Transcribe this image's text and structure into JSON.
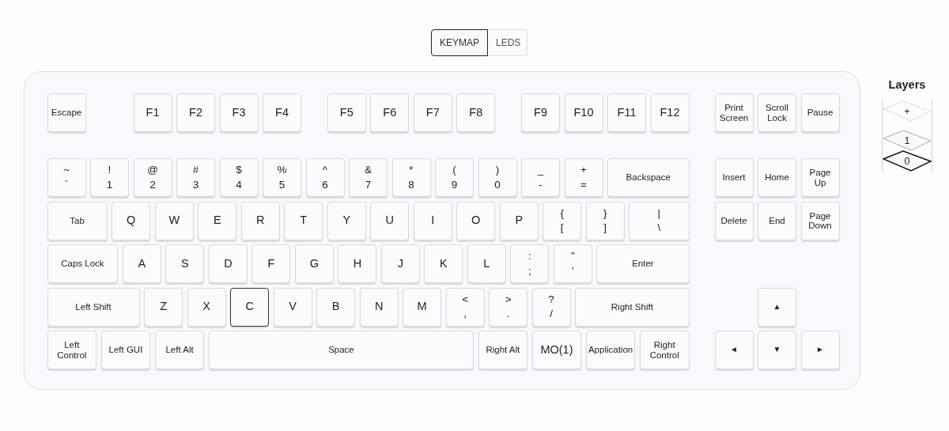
{
  "mode_tabs": [
    {
      "label": "KEYMAP",
      "selected": true
    },
    {
      "label": "LEDS",
      "selected": false
    }
  ],
  "keyboard": {
    "main_rows": [
      [
        {
          "kind": "name",
          "label": "Escape",
          "selected": false
        },
        {
          "kind": "legend",
          "label": "F1",
          "selected": false
        },
        {
          "kind": "legend",
          "label": "F2",
          "selected": false
        },
        {
          "kind": "legend",
          "label": "F3",
          "selected": false
        },
        {
          "kind": "legend",
          "label": "F4",
          "selected": false
        },
        {
          "kind": "legend",
          "label": "F5",
          "selected": false
        },
        {
          "kind": "legend",
          "label": "F6",
          "selected": false
        },
        {
          "kind": "legend",
          "label": "F7",
          "selected": false
        },
        {
          "kind": "legend",
          "label": "F8",
          "selected": false
        },
        {
          "kind": "legend",
          "label": "F9",
          "selected": false
        },
        {
          "kind": "legend",
          "label": "F10",
          "selected": false
        },
        {
          "kind": "legend",
          "label": "F11",
          "selected": false
        },
        {
          "kind": "legend",
          "label": "F12",
          "selected": false
        }
      ],
      [
        {
          "kind": "dual",
          "shifted": "~",
          "label": "`",
          "selected": false
        },
        {
          "kind": "dual",
          "shifted": "!",
          "label": "1",
          "selected": false
        },
        {
          "kind": "dual",
          "shifted": "@",
          "label": "2",
          "selected": false
        },
        {
          "kind": "dual",
          "shifted": "#",
          "label": "3",
          "selected": false
        },
        {
          "kind": "dual",
          "shifted": "$",
          "label": "4",
          "selected": false
        },
        {
          "kind": "dual",
          "shifted": "%",
          "label": "5",
          "selected": false
        },
        {
          "kind": "dual",
          "shifted": "^",
          "label": "6",
          "selected": false
        },
        {
          "kind": "dual",
          "shifted": "&",
          "label": "7",
          "selected": false
        },
        {
          "kind": "dual",
          "shifted": "*",
          "label": "8",
          "selected": false
        },
        {
          "kind": "dual",
          "shifted": "(",
          "label": "9",
          "selected": false
        },
        {
          "kind": "dual",
          "shifted": ")",
          "label": "0",
          "selected": false
        },
        {
          "kind": "dual",
          "shifted": "_",
          "label": "-",
          "selected": false
        },
        {
          "kind": "dual",
          "shifted": "+",
          "label": "=",
          "selected": false
        },
        {
          "kind": "name",
          "label": "Backspace",
          "selected": false
        }
      ],
      [
        {
          "kind": "name",
          "label": "Tab",
          "selected": false
        },
        {
          "kind": "legend",
          "label": "Q",
          "selected": false
        },
        {
          "kind": "legend",
          "label": "W",
          "selected": false
        },
        {
          "kind": "legend",
          "label": "E",
          "selected": false
        },
        {
          "kind": "legend",
          "label": "R",
          "selected": false
        },
        {
          "kind": "legend",
          "label": "T",
          "selected": false
        },
        {
          "kind": "legend",
          "label": "Y",
          "selected": false
        },
        {
          "kind": "legend",
          "label": "U",
          "selected": false
        },
        {
          "kind": "legend",
          "label": "I",
          "selected": false
        },
        {
          "kind": "legend",
          "label": "O",
          "selected": false
        },
        {
          "kind": "legend",
          "label": "P",
          "selected": false
        },
        {
          "kind": "dual",
          "shifted": "{",
          "label": "[",
          "selected": false
        },
        {
          "kind": "dual",
          "shifted": "}",
          "label": "]",
          "selected": false
        },
        {
          "kind": "dual",
          "shifted": "|",
          "label": "\\",
          "selected": false
        }
      ],
      [
        {
          "kind": "name",
          "label": "Caps Lock",
          "selected": false
        },
        {
          "kind": "legend",
          "label": "A",
          "selected": false
        },
        {
          "kind": "legend",
          "label": "S",
          "selected": false
        },
        {
          "kind": "legend",
          "label": "D",
          "selected": false
        },
        {
          "kind": "legend",
          "label": "F",
          "selected": false
        },
        {
          "kind": "legend",
          "label": "G",
          "selected": false
        },
        {
          "kind": "legend",
          "label": "H",
          "selected": false
        },
        {
          "kind": "legend",
          "label": "J",
          "selected": false
        },
        {
          "kind": "legend",
          "label": "K",
          "selected": false
        },
        {
          "kind": "legend",
          "label": "L",
          "selected": false
        },
        {
          "kind": "dual",
          "shifted": ":",
          "label": ";",
          "selected": false
        },
        {
          "kind": "dual",
          "shifted": "\"",
          "label": "'",
          "selected": false
        },
        {
          "kind": "name",
          "label": "Enter",
          "selected": false
        }
      ],
      [
        {
          "kind": "name",
          "label": "Left Shift",
          "selected": false
        },
        {
          "kind": "legend",
          "label": "Z",
          "selected": false
        },
        {
          "kind": "legend",
          "label": "X",
          "selected": false
        },
        {
          "kind": "legend",
          "label": "C",
          "selected": true
        },
        {
          "kind": "legend",
          "label": "V",
          "selected": false
        },
        {
          "kind": "legend",
          "label": "B",
          "selected": false
        },
        {
          "kind": "legend",
          "label": "N",
          "selected": false
        },
        {
          "kind": "legend",
          "label": "M",
          "selected": false
        },
        {
          "kind": "dual",
          "shifted": "<",
          "label": ",",
          "selected": false
        },
        {
          "kind": "dual",
          "shifted": ">",
          "label": ".",
          "selected": false
        },
        {
          "kind": "dual",
          "shifted": "?",
          "label": "/",
          "selected": false
        },
        {
          "kind": "name",
          "label": "Right Shift",
          "selected": false
        }
      ],
      [
        {
          "kind": "name",
          "label": "Left Control",
          "selected": false
        },
        {
          "kind": "name",
          "label": "Left GUI",
          "selected": false
        },
        {
          "kind": "name",
          "label": "Left Alt",
          "selected": false
        },
        {
          "kind": "name",
          "label": "Space",
          "selected": false
        },
        {
          "kind": "name",
          "label": "Right Alt",
          "selected": false
        },
        {
          "kind": "legend",
          "label": "MO(1)",
          "selected": false
        },
        {
          "kind": "name",
          "label": "Application",
          "selected": false
        },
        {
          "kind": "name",
          "label": "Right Control",
          "selected": false
        }
      ]
    ],
    "nav_rows": [
      [
        {
          "kind": "name",
          "label": "Print Screen",
          "selected": false
        },
        {
          "kind": "name",
          "label": "Scroll Lock",
          "selected": false
        },
        {
          "kind": "name",
          "label": "Pause",
          "selected": false
        }
      ],
      [
        {
          "kind": "name",
          "label": "Insert",
          "selected": false
        },
        {
          "kind": "name",
          "label": "Home",
          "selected": false
        },
        {
          "kind": "name",
          "label": "Page Up",
          "selected": false
        }
      ],
      [
        {
          "kind": "name",
          "label": "Delete",
          "selected": false
        },
        {
          "kind": "name",
          "label": "End",
          "selected": false
        },
        {
          "kind": "name",
          "label": "Page Down",
          "selected": false
        }
      ],
      [],
      [
        {
          "kind": "arrow",
          "label": "▲",
          "selected": false
        }
      ],
      [
        {
          "kind": "arrow",
          "label": "◄",
          "selected": false
        },
        {
          "kind": "arrow",
          "label": "▼",
          "selected": false
        },
        {
          "kind": "arrow",
          "label": "►",
          "selected": false
        }
      ]
    ]
  },
  "layers": {
    "title": "Layers",
    "items": [
      {
        "kind": "add",
        "label": "+",
        "selected": false
      },
      {
        "kind": "layer",
        "label": "1",
        "selected": false
      },
      {
        "kind": "layer",
        "label": "0",
        "selected": true
      }
    ]
  }
}
